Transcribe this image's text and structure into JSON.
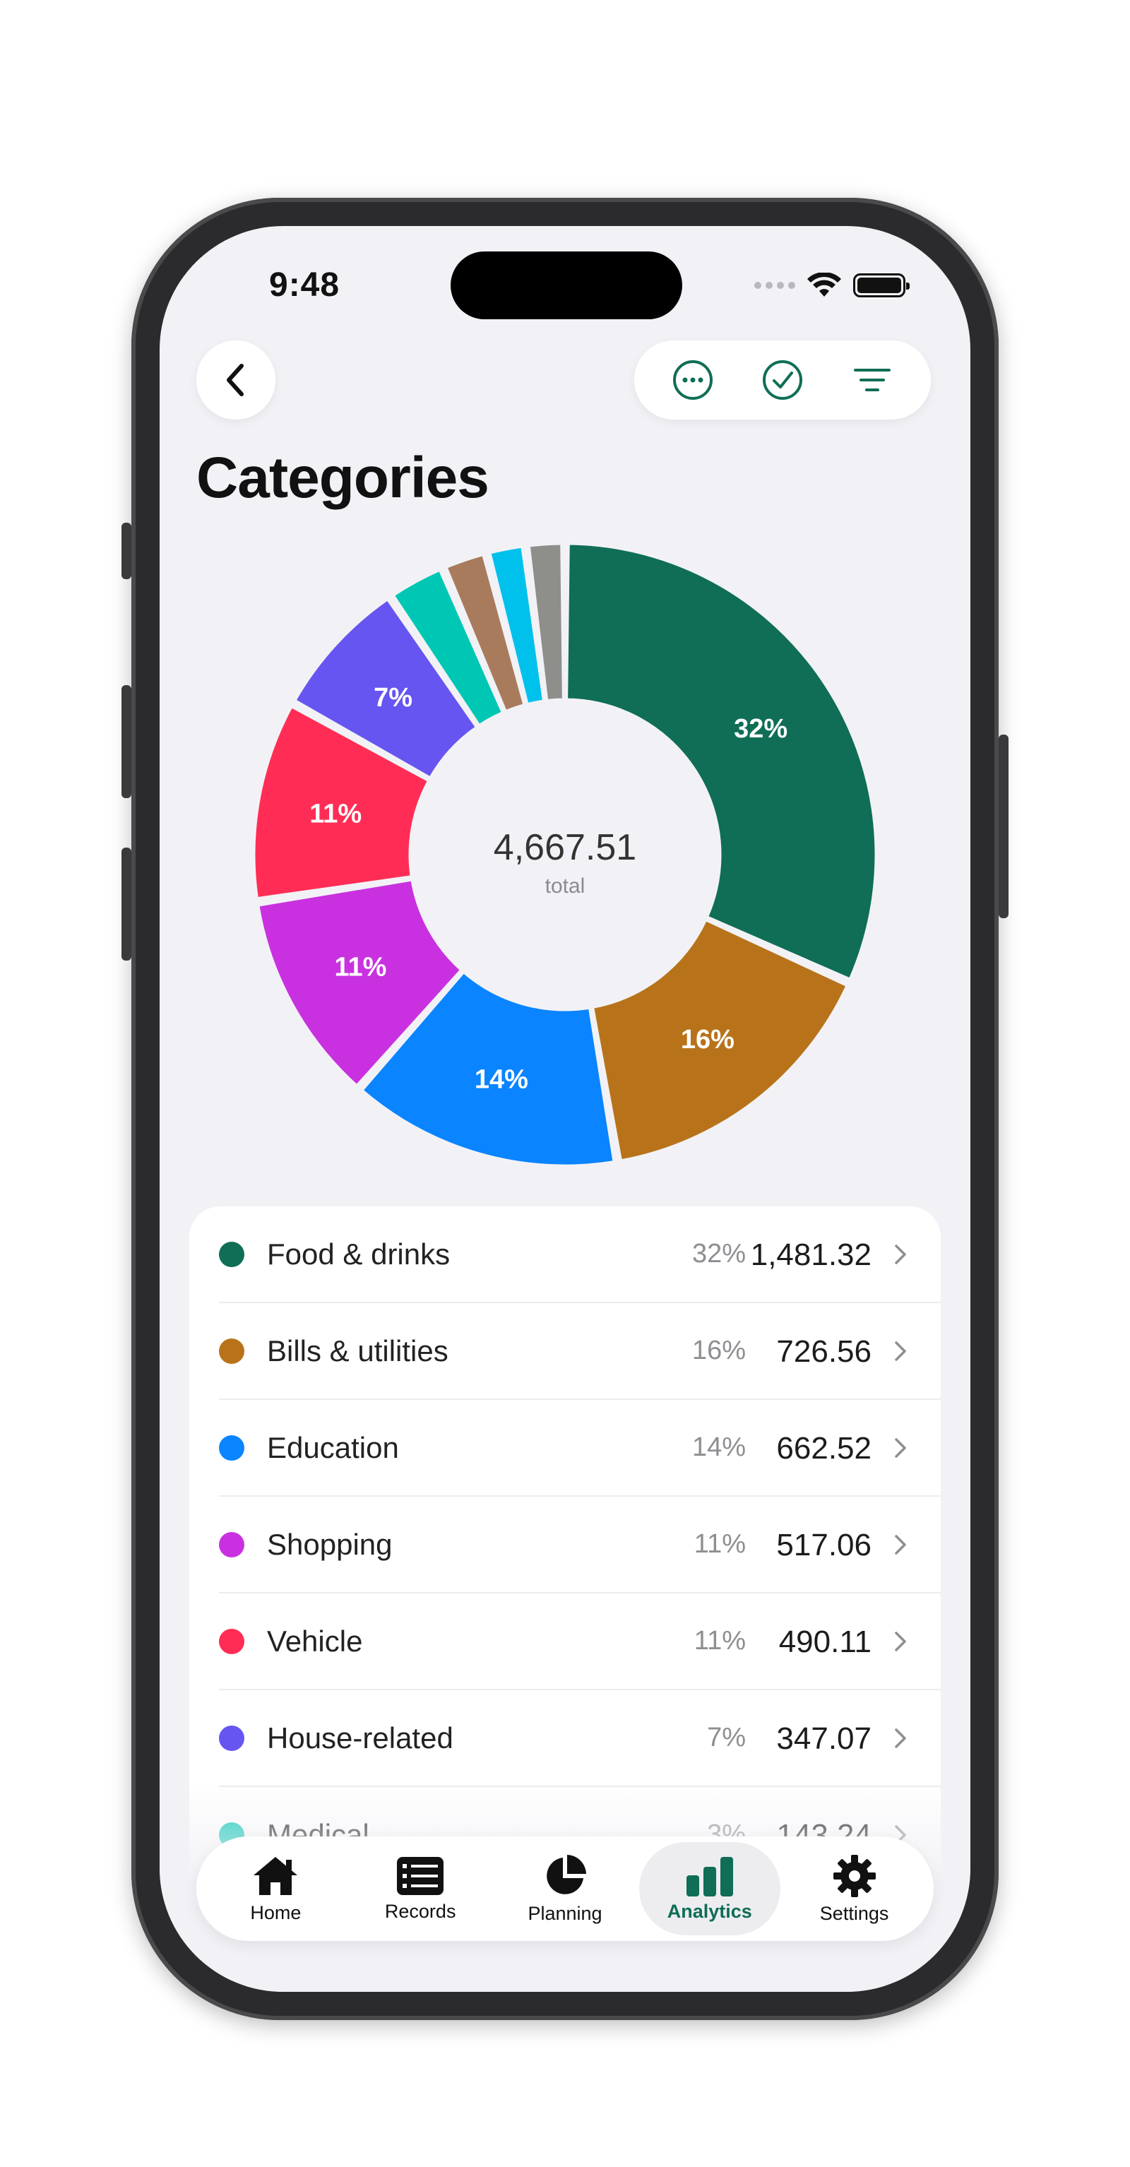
{
  "status": {
    "time": "9:48"
  },
  "header": {
    "back_icon": "chevron-left-icon",
    "actions": [
      {
        "id": "more",
        "icon": "ellipsis-circle-icon"
      },
      {
        "id": "check",
        "icon": "checkmark-circle-icon"
      },
      {
        "id": "filter",
        "icon": "filter-lines-icon"
      }
    ]
  },
  "page_title": "Categories",
  "chart_data": {
    "type": "pie",
    "total_value": "4,667.51",
    "total_label": "total",
    "slices": [
      {
        "name": "Food & drinks",
        "value": 1481.32,
        "label": "32%",
        "color": "#0f6e55"
      },
      {
        "name": "Bills & utilities",
        "value": 726.56,
        "label": "16%",
        "color": "#b8731a"
      },
      {
        "name": "Education",
        "value": 662.52,
        "label": "14%",
        "color": "#0a84ff"
      },
      {
        "name": "Shopping",
        "value": 517.06,
        "label": "11%",
        "color": "#c931e0"
      },
      {
        "name": "Vehicle",
        "value": 490.11,
        "label": "11%",
        "color": "#ff2d55"
      },
      {
        "name": "House-related",
        "value": 347.07,
        "label": "7%",
        "color": "#6655f0"
      },
      {
        "name": "Medical",
        "value": 143.24,
        "label": "",
        "color": "#00c7b4"
      },
      {
        "name": "",
        "value": 110,
        "label": "",
        "color": "#a97b5d"
      },
      {
        "name": "",
        "value": 95,
        "label": "",
        "color": "#00c1ec"
      },
      {
        "name": "",
        "value": 94.63,
        "label": "",
        "color": "#8e8e8a"
      }
    ]
  },
  "categories": [
    {
      "name": "Food & drinks",
      "percent": "32%",
      "amount": "1,481.32",
      "color": "#0f6e55"
    },
    {
      "name": "Bills & utilities",
      "percent": "16%",
      "amount": "726.56",
      "color": "#b8731a"
    },
    {
      "name": "Education",
      "percent": "14%",
      "amount": "662.52",
      "color": "#0a84ff"
    },
    {
      "name": "Shopping",
      "percent": "11%",
      "amount": "517.06",
      "color": "#c931e0"
    },
    {
      "name": "Vehicle",
      "percent": "11%",
      "amount": "490.11",
      "color": "#ff2d55"
    },
    {
      "name": "House-related",
      "percent": "7%",
      "amount": "347.07",
      "color": "#6655f0"
    },
    {
      "name": "Medical",
      "percent": "3%",
      "amount": "143.24",
      "color": "#00c7b4"
    }
  ],
  "tabbar": {
    "items": [
      {
        "label": "Home",
        "icon": "house-icon"
      },
      {
        "label": "Records",
        "icon": "list-card-icon"
      },
      {
        "label": "Planning",
        "icon": "pie-chart-icon"
      },
      {
        "label": "Analytics",
        "icon": "bar-chart-icon"
      },
      {
        "label": "Settings",
        "icon": "gear-icon"
      }
    ],
    "active_index": 3,
    "accent": "#0f6e55"
  }
}
